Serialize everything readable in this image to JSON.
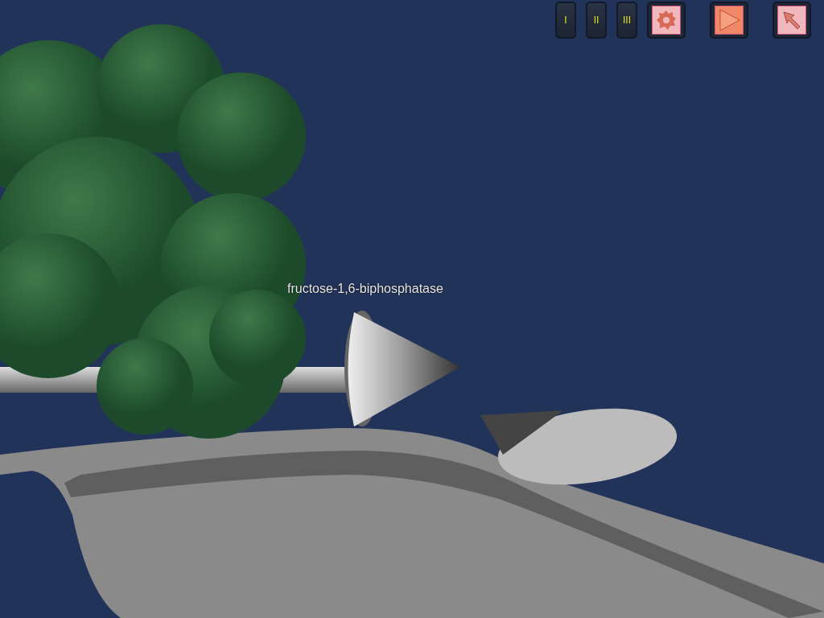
{
  "toolbar": {
    "levels": [
      {
        "label": "I"
      },
      {
        "label": "II"
      },
      {
        "label": "III"
      }
    ],
    "tools": [
      {
        "kind": "gear",
        "selected": false
      },
      {
        "kind": "play",
        "selected": true
      },
      {
        "kind": "pointer",
        "selected": false
      }
    ]
  },
  "scene": {
    "label": "fructose-1,6-biphosphatase"
  }
}
